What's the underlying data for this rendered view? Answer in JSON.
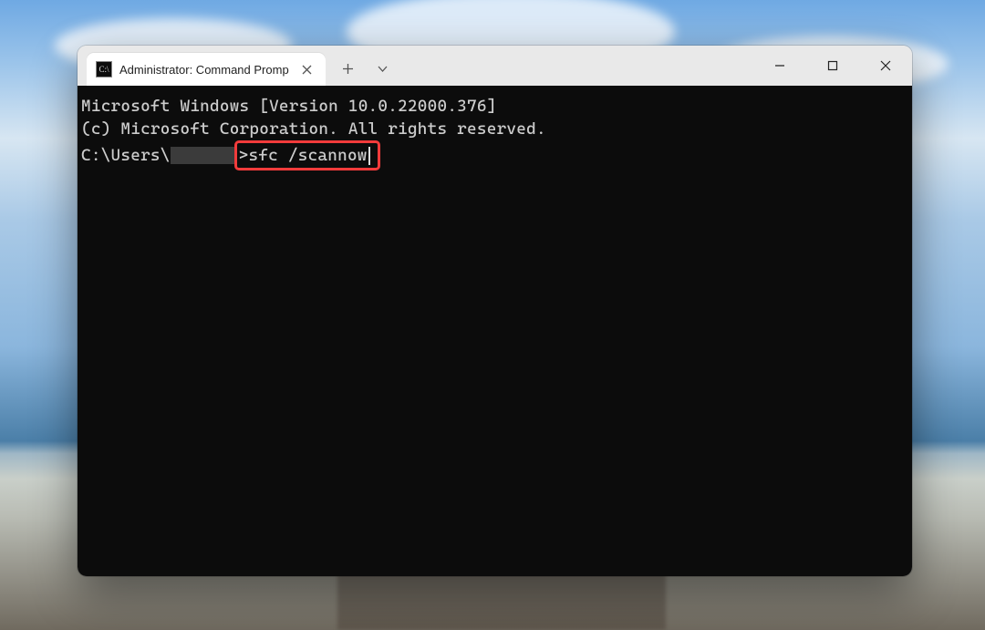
{
  "window": {
    "tab_title": "Administrator: Command Promp",
    "icon_glyph": "C:\\"
  },
  "terminal": {
    "line1": "Microsoft Windows [Version 10.0.22000.376]",
    "line2": "(c) Microsoft Corporation. All rights reserved.",
    "blank": "",
    "prompt_prefix": "C:\\Users\\",
    "prompt_suffix": ">",
    "command": "sfc /scannow"
  }
}
